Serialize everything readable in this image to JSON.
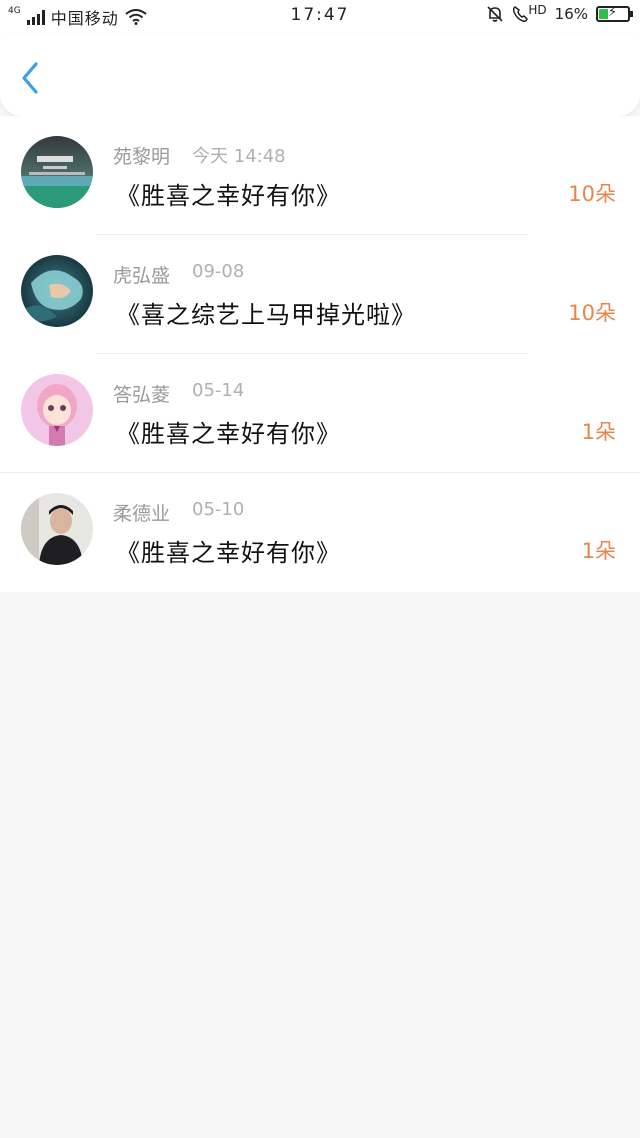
{
  "status_bar": {
    "network": "4G",
    "carrier": "中国移动",
    "time": "17:47",
    "hd": "HD",
    "battery": "16%"
  },
  "colors": {
    "accent": "#3aa0e8",
    "count": "#e8854a"
  },
  "items": [
    {
      "name": "苑黎明",
      "date": "今天 14:48",
      "title": "《胜喜之幸好有你》",
      "count": "10朵"
    },
    {
      "name": "虎弘盛",
      "date": "09-08",
      "title": "《喜之综艺上马甲掉光啦》",
      "count": "10朵"
    },
    {
      "name": "答弘菱",
      "date": "05-14",
      "title": "《胜喜之幸好有你》",
      "count": "1朵"
    },
    {
      "name": "柔德业",
      "date": "05-10",
      "title": "《胜喜之幸好有你》",
      "count": "1朵"
    }
  ]
}
